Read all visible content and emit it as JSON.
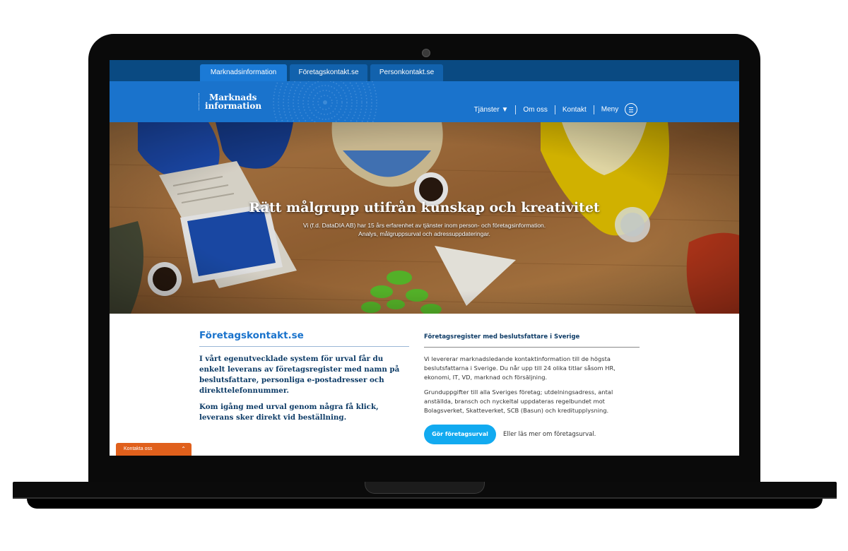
{
  "site_tabs": {
    "marknad": "Marknadsinformation",
    "foretag": "Företagskontakt.se",
    "person": "Personkontakt.se"
  },
  "logo": {
    "line1": "Marknads",
    "line2": "information"
  },
  "nav": {
    "tjanster": "Tjänster ▼",
    "om": "Om oss",
    "kontakt": "Kontakt",
    "meny": "Meny"
  },
  "hero": {
    "title": "Rätt målgrupp utifrån kunskap och kreativitet",
    "line1": "Vi (f.d. DataDIA AB) har 15 års erfarenhet av tjänster inom person- och företagsinformation.",
    "line2": "Analys, målgruppsurval och adressuppdateringar."
  },
  "main": {
    "title": "Företagskontakt.se",
    "lead1": "I vårt egenutvecklade system för urval får du enkelt leverans av företagsregister med namn på beslutsfattare, personliga e-postadresser och direkttelefonnummer.",
    "lead2": "Kom igång med urval genom några få klick, leverans sker direkt vid beställning."
  },
  "side": {
    "title": "Företagsregister med beslutsfattare i Sverige",
    "p1": "Vi levererar marknadsledande kontaktinformation till de högsta beslutsfattarna i Sverige. Du når upp till 24 olika titlar såsom HR, ekonomi, IT, VD, marknad och försäljning.",
    "p2": "Grunduppgifter till alla Sveriges företag; utdelningsadress, antal anställda, bransch och nyckeltal uppdateras regelbundet mot Bolagsverket, Skatteverket, SCB (Basun) och kreditupplysning.",
    "button": "Gör företagsurval",
    "alt_link": "Eller läs mer om företagsurval."
  },
  "contact_tab": {
    "label": "Kontakta oss",
    "icon": "chevron-up-icon"
  },
  "colors": {
    "topbar": "#0a4a82",
    "header": "#1a73cc",
    "cta": "#12aaf0",
    "contact": "#e0601c"
  }
}
